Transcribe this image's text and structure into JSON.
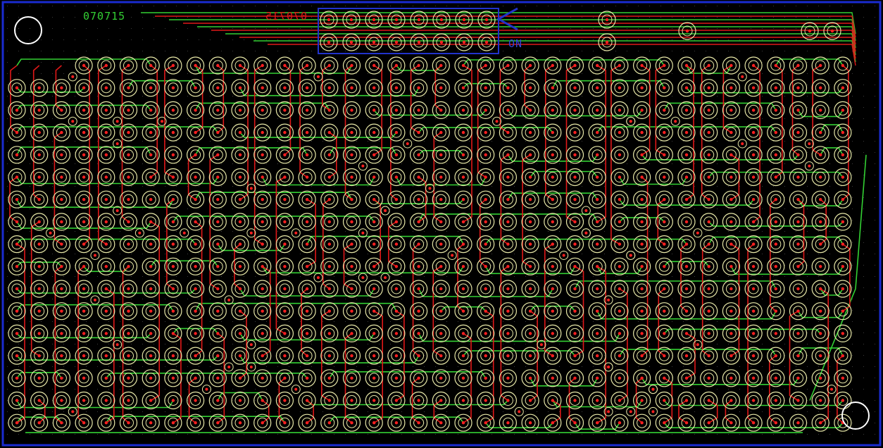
{
  "board": {
    "colors": {
      "background": "#000000",
      "outline": "#1a2bd0",
      "grid_dots": "#3b3b3b",
      "top_trace": "#e01818",
      "bottom_trace": "#33d033",
      "pad_ring": "#e8e8a8",
      "hole": "#ff2020",
      "mounting_hole": "#ffffff",
      "connector_outline": "#2233cc"
    },
    "labels": {
      "bottom_layer_mark": "070715",
      "top_layer_mark": "070715",
      "connector_mark": "ON"
    },
    "pad_grid": {
      "columns": 38,
      "rows": 17
    },
    "header_pins": 16,
    "mounting_holes": 2
  }
}
